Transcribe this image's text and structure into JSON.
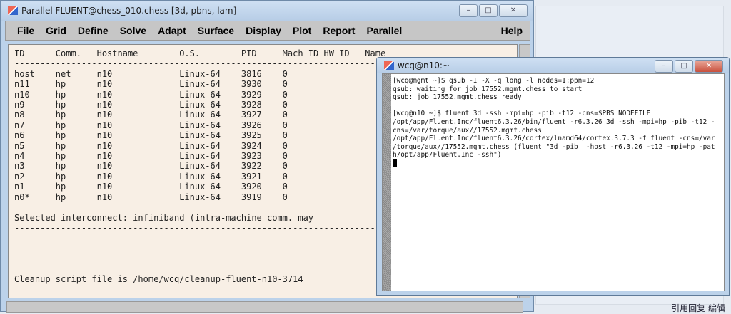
{
  "fluent": {
    "title": "Parallel FLUENT@chess_010.chess  [3d, pbns, lam]",
    "menu": [
      "File",
      "Grid",
      "Define",
      "Solve",
      "Adapt",
      "Surface",
      "Display",
      "Plot",
      "Report",
      "Parallel"
    ],
    "help": "Help",
    "console": "ID      Comm.   Hostname        O.S.        PID     Mach ID HW ID   Name\n-----------------------------------------------------------------------------\nhost    net     n10             Linux-64    3816    0\nn11     hp      n10             Linux-64    3930    0\nn10     hp      n10             Linux-64    3929    0\nn9      hp      n10             Linux-64    3928    0\nn8      hp      n10             Linux-64    3927    0\nn7      hp      n10             Linux-64    3926    0\nn6      hp      n10             Linux-64    3925    0\nn5      hp      n10             Linux-64    3924    0\nn4      hp      n10             Linux-64    3923    0\nn3      hp      n10             Linux-64    3922    0\nn2      hp      n10             Linux-64    3921    0\nn1      hp      n10             Linux-64    3920    0\nn0*     hp      n10             Linux-64    3919    0\n\nSelected interconnect: infiniband (intra-machine comm. may\n-----------------------------------------------------------------------------\n\n\n\n\nCleanup script file is /home/wcq/cleanup-fluent-n10-3714\n\n> "
  },
  "terminal": {
    "title": "wcq@n10:~",
    "content": "[wcq@mgmt ~]$ qsub -I -X -q long -l nodes=1:ppn=12\nqsub: waiting for job 17552.mgmt.chess to start\nqsub: job 17552.mgmt.chess ready\n\n[wcq@n10 ~]$ fluent 3d -ssh -mpi=hp -pib -t12 -cns=$PBS_NODEFILE\n/opt/app/Fluent.Inc/fluent6.3.26/bin/fluent -r6.3.26 3d -ssh -mpi=hp -pib -t12 -\ncns=/var/torque/aux//17552.mgmt.chess\n/opt/app/Fluent.Inc/fluent6.3.26/cortex/lnamd64/cortex.3.7.3 -f fluent -cns=/var\n/torque/aux//17552.mgmt.chess (fluent \"3d -pib  -host -r6.3.26 -t12 -mpi=hp -pat\nh/opt/app/Fluent.Inc -ssh\")\n"
  },
  "page": {
    "bottom_links": "引用回复  编辑"
  }
}
